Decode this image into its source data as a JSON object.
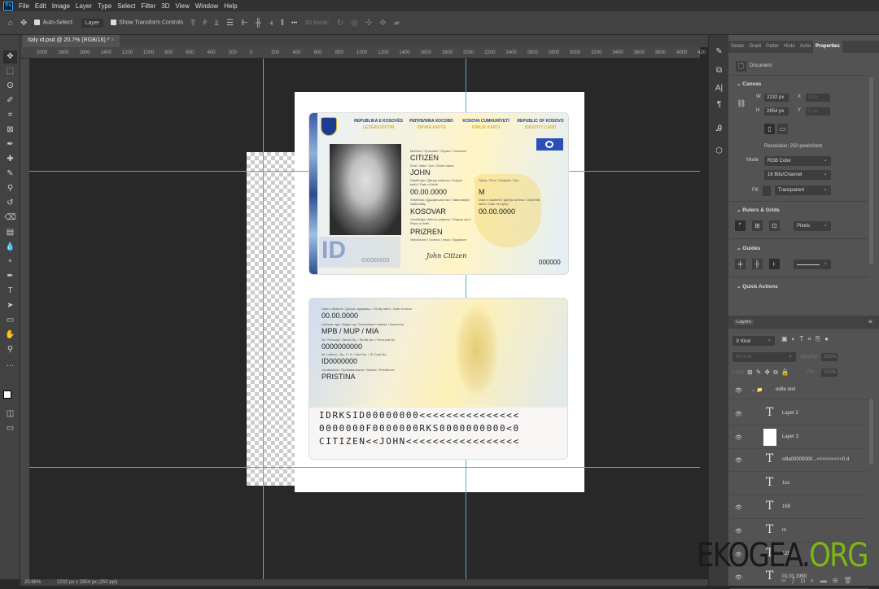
{
  "menu": [
    "File",
    "Edit",
    "Image",
    "Layer",
    "Type",
    "Select",
    "Filter",
    "3D",
    "View",
    "Window",
    "Help"
  ],
  "app_logo": "Ps",
  "options": {
    "auto_select": "Auto-Select:",
    "layer_select": "Layer",
    "show_transform": "Show Transform Controls",
    "more": "•••",
    "mode_3d": "3D Mode:"
  },
  "doc_tab": "Italy id.psd @ 20.7% (RGB/16) *",
  "ruler_labels": [
    "2000",
    "1800",
    "1600",
    "1400",
    "1200",
    "1000",
    "800",
    "600",
    "400",
    "200",
    "0",
    "200",
    "400",
    "600",
    "800",
    "1000",
    "1200",
    "1400",
    "1600",
    "1800",
    "2000",
    "2200",
    "2400",
    "2600",
    "2800",
    "3000",
    "3200",
    "3400",
    "3600",
    "3800",
    "4000",
    "420"
  ],
  "card_front": {
    "headers": [
      {
        "t": "REPUBLIKA E KOSOVËS",
        "s": "LETËRNJOFTIM"
      },
      {
        "t": "РЕПУБЛИКА КОСОВО",
        "s": "ЛИЧНА КАРТА"
      },
      {
        "t": "KOSOVA CUMHURİYETİ",
        "s": "KİMLİK KARTI"
      },
      {
        "t": "REPUBLIC OF KOSOVO",
        "s": "IDENTITY CARD"
      }
    ],
    "surname_label": "Mbiemri / Презиме / Soyadı / Surname",
    "surname": "CITIZEN",
    "given_label": "Emri / Име / Adı / Given name",
    "given": "JOHN",
    "dob_label": "Datëlindja / Датум рођења / Doğum tarihi / Date of birth",
    "dob": "00.00.0000",
    "sex_label": "Gjinia / Пол / Cinsiyeti / Sex",
    "sex": "M",
    "nat_label": "Shtetësia / Држављанство / Vatandaşlık / Nationality",
    "nat": "KOSOVAR",
    "exp_label": "Data e skadimit / Датум истека / Geçerlilik tarihi / Date of expiry",
    "exp": "00.00.0000",
    "pob_label": "Vendlindja / Место рођења / Doğum yeri / Place of birth",
    "pob": "PRIZREN",
    "sig_label": "Nënshkrimi / Потпис / İmza / Signature",
    "signature": "John Citizen",
    "id_ghost": "ID0000000",
    "ib": "ID",
    "number": "000000"
  },
  "card_back": {
    "issue_label": "Data e lëshimit / Датум издавања / Veriliş tarihi / Date of issue",
    "issue": "00.00.0000",
    "by_label": "Lëshuar nga / Издат од / Düzenleyen makam / Issued by",
    "by": "MPB / MUP / MIA",
    "pn_label": "Nr. Personal / Лични бр. / Kimlik No. / Personal No.",
    "pn": "0000000000",
    "card_label": "Nr. Letërnj. / Бр. Л. К. / Kart No. / ID Card No.",
    "card": "ID0000000",
    "res_label": "Vendbanimi / Пребивалиште / İkamet / Residence",
    "res": "PRISTINA",
    "mrz": [
      "IDRKSID00000000<<<<<<<<<<<<<<<",
      "0000000F0000000RKS0000000000<0",
      "CITIZEN<<JOHN<<<<<<<<<<<<<<<<<"
    ]
  },
  "properties": {
    "tabs": [
      "Swatc",
      "Gradi",
      "Patter",
      "Histo",
      "Actio",
      "Properties"
    ],
    "document": "Document",
    "canvas": "Canvas",
    "w_label": "W",
    "w": "2232 px",
    "h_label": "H",
    "h": "2854 px",
    "x_label": "X",
    "y_label": "Y",
    "x": "0 px",
    "y": "0 px",
    "resolution": "Resolution: 250 pixels/inch",
    "mode_label": "Mode",
    "mode": "RGB Color",
    "depth": "16 Bits/Channel",
    "fill_label": "Fill",
    "fill": "Transparent",
    "rulers": "Rulers & Grids",
    "units": "Pixels",
    "guides": "Guides",
    "quick": "Quick Actions"
  },
  "layers": {
    "title": "Layers",
    "kind": "Kind",
    "blend": "Normal",
    "opacity_label": "Opacity:",
    "opacity": "100%",
    "lock": "Lock:",
    "fill_label": "Fill:",
    "fill": "100%",
    "items": [
      {
        "name": "edite text",
        "type": "group",
        "visible": true
      },
      {
        "name": "Layer 2",
        "type": "text",
        "visible": true
      },
      {
        "name": "Layer 3",
        "type": "image",
        "visible": true
      },
      {
        "name": "citla00000000...<<<<<<<<<0 d",
        "type": "text",
        "visible": true
      },
      {
        "name": "1ss",
        "type": "text",
        "visible": false
      },
      {
        "name": "169",
        "type": "text",
        "visible": true
      },
      {
        "name": "m",
        "type": "text",
        "visible": true
      },
      {
        "name": "125",
        "type": "text",
        "visible": true
      },
      {
        "name": "01.01.1990",
        "type": "text",
        "visible": true
      }
    ]
  },
  "status": {
    "zoom": "20.66%",
    "doc_size": "2232 px x 2854 px (250 ppi)"
  },
  "watermark": {
    "a": "EKOGEA.",
    "b": "ORG",
    "color_a": "#1a1a1a",
    "color_b": "#7cb518"
  },
  "colors": {
    "guide": "#3fb6c1",
    "accent": "#31a8ff"
  }
}
